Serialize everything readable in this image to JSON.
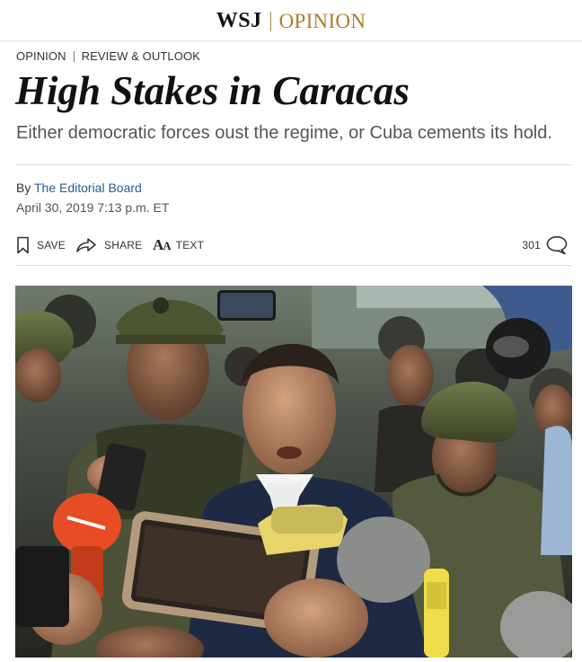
{
  "masthead": {
    "brand": "WSJ",
    "section": "OPINION"
  },
  "breadcrumb": {
    "section": "OPINION",
    "column": "REVIEW & OUTLOOK"
  },
  "article": {
    "headline": "High Stakes in Caracas",
    "dek": "Either democratic forces oust the regime, or Cuba cements its hold.",
    "byline_prefix": "By",
    "author": "The Editorial Board",
    "timestamp": "April 30, 2019 7:13 p.m. ET"
  },
  "toolbar": {
    "save_label": "SAVE",
    "share_label": "SHARE",
    "text_label": "TEXT",
    "comment_count": "301"
  },
  "icons": {
    "save": "bookmark-icon",
    "share": "share-arrow-icon",
    "text": "text-size-icon",
    "comments": "comment-bubble-icon"
  },
  "colors": {
    "opinion_gold": "#b07b2c",
    "link_blue": "#1e5f99",
    "rule_gray": "#d9d9d9"
  }
}
